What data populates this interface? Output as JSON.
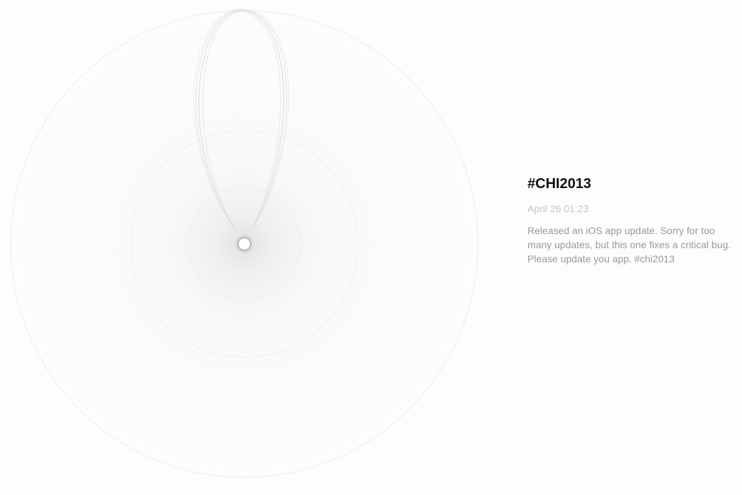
{
  "topic": {
    "hashtag": "#CHI2013",
    "timestamp": "April 26 01:23",
    "message": "Released an iOS app update. Sorry for too many updates, but this one fixes a critical bug. Please update you app. #chi2013"
  },
  "colors": {
    "background": "#fdfdfc",
    "title": "#111111",
    "timestamp": "#c4c4c4",
    "message": "#999999",
    "circle_stroke": "#ececec",
    "loop_stroke": "#d4d4d4"
  }
}
